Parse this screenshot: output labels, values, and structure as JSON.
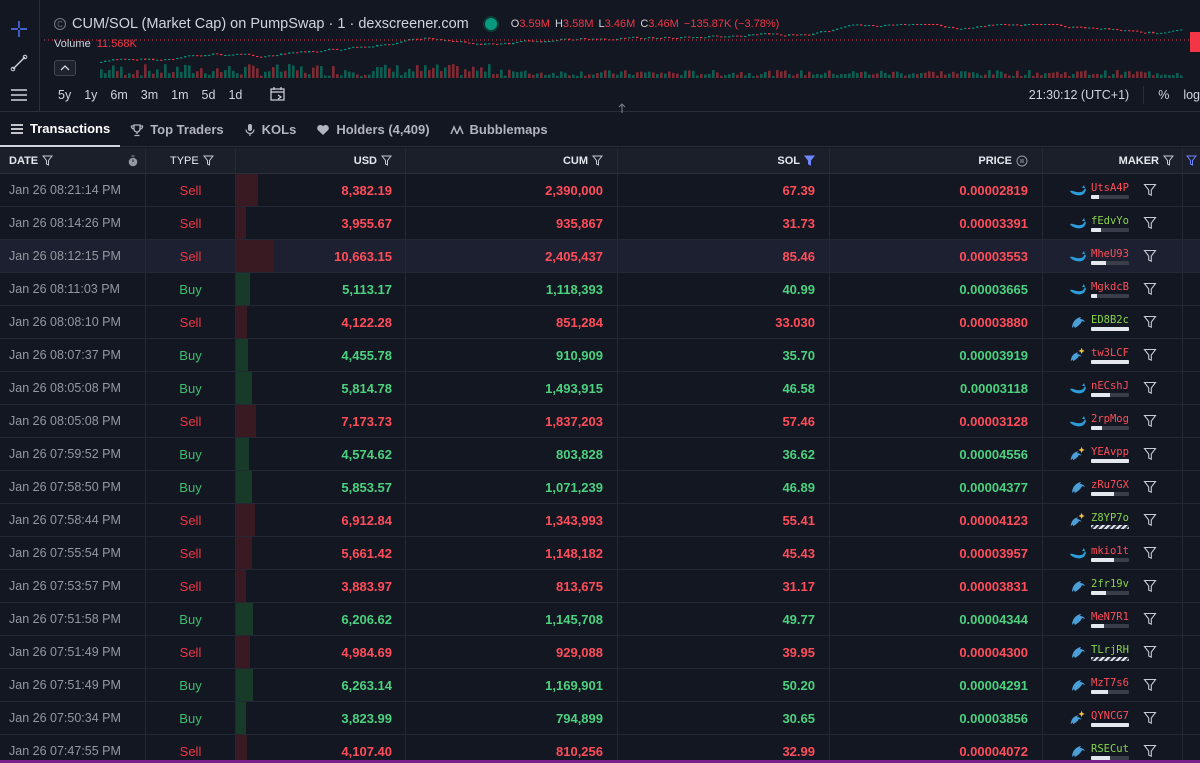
{
  "chart": {
    "title": "CUM/SOL (Market Cap) on PumpSwap · 1 · dexscreener.com",
    "ohlc": {
      "o_label": "O",
      "o": "3.59M",
      "h_label": "H",
      "h": "3.58M",
      "l_label": "L",
      "l": "3.46M",
      "c_label": "C",
      "c": "3.46M",
      "change": "−135.87K (−3.78%)"
    },
    "volume_label": "Volume",
    "volume_value": "11.568K",
    "timeframes": [
      "5y",
      "1y",
      "6m",
      "3m",
      "1m",
      "5d",
      "1d"
    ],
    "clock": "21:30:12 (UTC+1)",
    "percent_label": "%",
    "log_label": "log"
  },
  "tabs": [
    {
      "label": "Transactions",
      "icon": "list-icon",
      "active": true
    },
    {
      "label": "Top Traders",
      "icon": "trophy-icon"
    },
    {
      "label": "KOLs",
      "icon": "microphone-icon"
    },
    {
      "label": "Holders (4,409)",
      "icon": "heart-icon"
    },
    {
      "label": "Bubblemaps",
      "icon": "bubblemaps-icon"
    }
  ],
  "table": {
    "headers": {
      "date": "DATE",
      "type": "TYPE",
      "usd": "USD",
      "cum": "CUM",
      "sol": "SOL",
      "price": "PRICE",
      "maker": "MAKER"
    },
    "rows": [
      {
        "date": "Jan 26 08:21:14 PM",
        "type": "Sell",
        "usd": "8,382.19",
        "cum": "2,390,000",
        "sol": "67.39",
        "price": "0.00002819",
        "maker": "UtsA4P",
        "maker_color": "red",
        "icon": "whale",
        "bar": 0.55,
        "wbar": 0.2
      },
      {
        "date": "Jan 26 08:14:26 PM",
        "type": "Sell",
        "usd": "3,955.67",
        "cum": "935,867",
        "sol": "31.73",
        "price": "0.00003391",
        "maker": "fEdvYo",
        "maker_color": "green",
        "icon": "whale",
        "bar": 0.25,
        "wbar": 0.25
      },
      {
        "date": "Jan 26 08:12:15 PM",
        "type": "Sell",
        "usd": "10,663.15",
        "cum": "2,405,437",
        "sol": "85.46",
        "price": "0.00003553",
        "maker": "MheU93",
        "maker_color": "red",
        "icon": "whale",
        "bar": 0.95,
        "wbar": 0.4
      },
      {
        "date": "Jan 26 08:11:03 PM",
        "type": "Buy",
        "usd": "5,113.17",
        "cum": "1,118,393",
        "sol": "40.99",
        "price": "0.00003665",
        "maker": "MgkdcB",
        "maker_color": "red",
        "icon": "whale",
        "bar": 0.35,
        "wbar": 0.15
      },
      {
        "date": "Jan 26 08:08:10 PM",
        "type": "Sell",
        "usd": "4,122.28",
        "cum": "851,284",
        "sol": "33.030",
        "price": "0.00003880",
        "maker": "ED8B2c",
        "maker_color": "green",
        "icon": "dolphin",
        "bar": 0.28,
        "wbar": 1.0
      },
      {
        "date": "Jan 26 08:07:37 PM",
        "type": "Buy",
        "usd": "4,455.78",
        "cum": "910,909",
        "sol": "35.70",
        "price": "0.00003919",
        "maker": "tw3LCF",
        "maker_color": "red",
        "icon": "sparkle-dolphin",
        "bar": 0.3,
        "wbar": 1.0
      },
      {
        "date": "Jan 26 08:05:08 PM",
        "type": "Buy",
        "usd": "5,814.78",
        "cum": "1,493,915",
        "sol": "46.58",
        "price": "0.00003118",
        "maker": "nECshJ",
        "maker_color": "red",
        "icon": "whale",
        "bar": 0.4,
        "wbar": 0.5
      },
      {
        "date": "Jan 26 08:05:08 PM",
        "type": "Sell",
        "usd": "7,173.73",
        "cum": "1,837,203",
        "sol": "57.46",
        "price": "0.00003128",
        "maker": "2rpMog",
        "maker_color": "red",
        "icon": "whale",
        "bar": 0.5,
        "wbar": 0.3
      },
      {
        "date": "Jan 26 07:59:52 PM",
        "type": "Buy",
        "usd": "4,574.62",
        "cum": "803,828",
        "sol": "36.62",
        "price": "0.00004556",
        "maker": "YEAvpp",
        "maker_color": "red",
        "icon": "sparkle-dolphin",
        "bar": 0.32,
        "wbar": 1.0
      },
      {
        "date": "Jan 26 07:58:50 PM",
        "type": "Buy",
        "usd": "5,853.57",
        "cum": "1,071,239",
        "sol": "46.89",
        "price": "0.00004377",
        "maker": "zRu7GX",
        "maker_color": "red",
        "icon": "dolphin",
        "bar": 0.4,
        "wbar": 0.6
      },
      {
        "date": "Jan 26 07:58:44 PM",
        "type": "Sell",
        "usd": "6,912.84",
        "cum": "1,343,993",
        "sol": "55.41",
        "price": "0.00004123",
        "maker": "Z8YP7o",
        "maker_color": "green",
        "icon": "sparkle-dolphin",
        "bar": 0.48,
        "wbar": -1
      },
      {
        "date": "Jan 26 07:55:54 PM",
        "type": "Sell",
        "usd": "5,661.42",
        "cum": "1,148,182",
        "sol": "45.43",
        "price": "0.00003957",
        "maker": "mkio1t",
        "maker_color": "red",
        "icon": "whale",
        "bar": 0.4,
        "wbar": 0.6
      },
      {
        "date": "Jan 26 07:53:57 PM",
        "type": "Sell",
        "usd": "3,883.97",
        "cum": "813,675",
        "sol": "31.17",
        "price": "0.00003831",
        "maker": "2fr19v",
        "maker_color": "green",
        "icon": "dolphin",
        "bar": 0.25,
        "wbar": 0.4
      },
      {
        "date": "Jan 26 07:51:58 PM",
        "type": "Buy",
        "usd": "6,206.62",
        "cum": "1,145,708",
        "sol": "49.77",
        "price": "0.00004344",
        "maker": "MeN7R1",
        "maker_color": "red",
        "icon": "dolphin",
        "bar": 0.43,
        "wbar": 0.35
      },
      {
        "date": "Jan 26 07:51:49 PM",
        "type": "Sell",
        "usd": "4,984.69",
        "cum": "929,088",
        "sol": "39.95",
        "price": "0.00004300",
        "maker": "TLrjRH",
        "maker_color": "green",
        "icon": "dolphin",
        "bar": 0.34,
        "wbar": -1
      },
      {
        "date": "Jan 26 07:51:49 PM",
        "type": "Buy",
        "usd": "6,263.14",
        "cum": "1,169,901",
        "sol": "50.20",
        "price": "0.00004291",
        "maker": "MzT7s6",
        "maker_color": "red",
        "icon": "dolphin",
        "bar": 0.43,
        "wbar": 0.45
      },
      {
        "date": "Jan 26 07:50:34 PM",
        "type": "Buy",
        "usd": "3,823.99",
        "cum": "794,899",
        "sol": "30.65",
        "price": "0.00003856",
        "maker": "QYNCG7",
        "maker_color": "red",
        "icon": "sparkle-dolphin",
        "bar": 0.24,
        "wbar": 1.0
      },
      {
        "date": "Jan 26 07:47:55 PM",
        "type": "Sell",
        "usd": "4,107.40",
        "cum": "810,256",
        "sol": "32.99",
        "price": "0.00004072",
        "maker": "RSECut",
        "maker_color": "green",
        "icon": "dolphin",
        "bar": 0.27,
        "wbar": 0.5
      }
    ]
  },
  "colors": {
    "sell": "#f23645",
    "buy": "#3dbd6f",
    "background": "#131722",
    "accent": "#4f7cff"
  }
}
